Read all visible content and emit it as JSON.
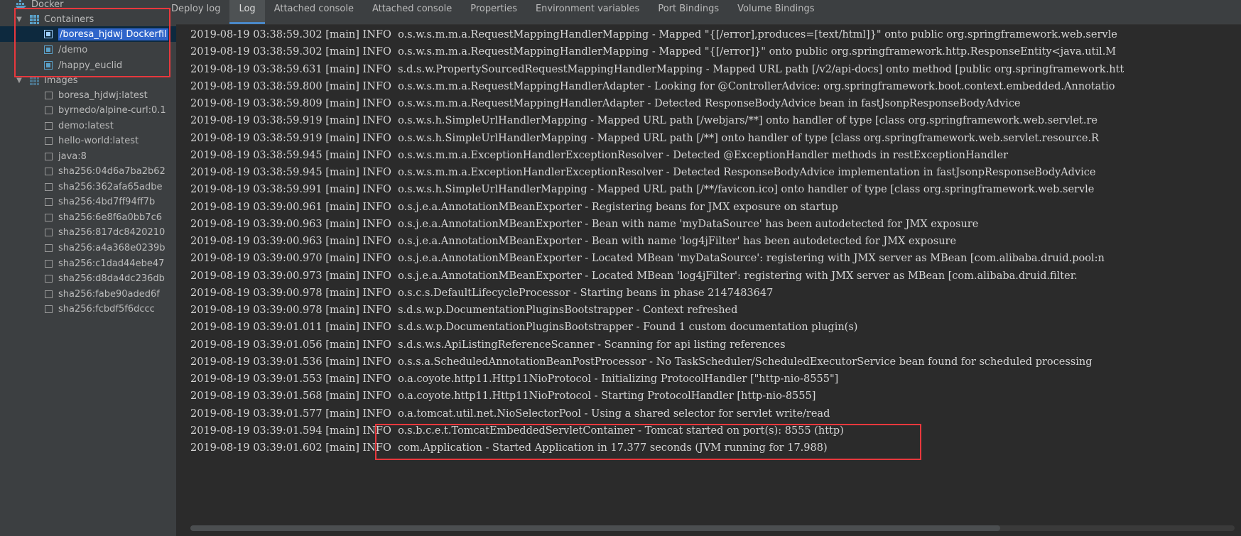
{
  "sidebar": {
    "root": "Docker",
    "containers_label": "Containers",
    "containers": [
      "/boresa_hjdwj Dockerfil",
      "/demo",
      "/happy_euclid"
    ],
    "images_label": "Images",
    "images": [
      "boresa_hjdwj:latest",
      "byrnedo/alpine-curl:0.1",
      "demo:latest",
      "hello-world:latest",
      "java:8",
      "sha256:04d6a7ba2b62",
      "sha256:362afa65adbe",
      "sha256:4bd7ff94ff7b",
      "sha256:6e8f6a0bb7c6",
      "sha256:817dc8420210",
      "sha256:a4a368e0239b",
      "sha256:c1dad44ebe47",
      "sha256:d8da4dc236db",
      "sha256:fabe90aded6f",
      "sha256:fcbdf5f6dccc"
    ]
  },
  "tabs": [
    {
      "label": "Deploy log",
      "active": false
    },
    {
      "label": "Log",
      "active": true
    },
    {
      "label": "Attached console",
      "active": false
    },
    {
      "label": "Attached console",
      "active": false
    },
    {
      "label": "Properties",
      "active": false
    },
    {
      "label": "Environment variables",
      "active": false
    },
    {
      "label": "Port Bindings",
      "active": false
    },
    {
      "label": "Volume Bindings",
      "active": false
    }
  ],
  "log_lines": [
    "2019-08-19 03:38:59.302 [main] INFO  o.s.w.s.m.m.a.RequestMappingHandlerMapping - Mapped \"{[/error],produces=[text/html]}\" onto public org.springframework.web.servle",
    "2019-08-19 03:38:59.302 [main] INFO  o.s.w.s.m.m.a.RequestMappingHandlerMapping - Mapped \"{[/error]}\" onto public org.springframework.http.ResponseEntity<java.util.M",
    "2019-08-19 03:38:59.631 [main] INFO  s.d.s.w.PropertySourcedRequestMappingHandlerMapping - Mapped URL path [/v2/api-docs] onto method [public org.springframework.htt",
    "2019-08-19 03:38:59.800 [main] INFO  o.s.w.s.m.m.a.RequestMappingHandlerAdapter - Looking for @ControllerAdvice: org.springframework.boot.context.embedded.Annotatio",
    "2019-08-19 03:38:59.809 [main] INFO  o.s.w.s.m.m.a.RequestMappingHandlerAdapter - Detected ResponseBodyAdvice bean in fastJsonpResponseBodyAdvice",
    "2019-08-19 03:38:59.919 [main] INFO  o.s.w.s.h.SimpleUrlHandlerMapping - Mapped URL path [/webjars/**] onto handler of type [class org.springframework.web.servlet.re",
    "2019-08-19 03:38:59.919 [main] INFO  o.s.w.s.h.SimpleUrlHandlerMapping - Mapped URL path [/**] onto handler of type [class org.springframework.web.servlet.resource.R",
    "2019-08-19 03:38:59.945 [main] INFO  o.s.w.s.m.m.a.ExceptionHandlerExceptionResolver - Detected @ExceptionHandler methods in restExceptionHandler",
    "2019-08-19 03:38:59.945 [main] INFO  o.s.w.s.m.m.a.ExceptionHandlerExceptionResolver - Detected ResponseBodyAdvice implementation in fastJsonpResponseBodyAdvice",
    "2019-08-19 03:38:59.991 [main] INFO  o.s.w.s.h.SimpleUrlHandlerMapping - Mapped URL path [/**/favicon.ico] onto handler of type [class org.springframework.web.servle",
    "2019-08-19 03:39:00.961 [main] INFO  o.s.j.e.a.AnnotationMBeanExporter - Registering beans for JMX exposure on startup",
    "2019-08-19 03:39:00.963 [main] INFO  o.s.j.e.a.AnnotationMBeanExporter - Bean with name 'myDataSource' has been autodetected for JMX exposure",
    "2019-08-19 03:39:00.963 [main] INFO  o.s.j.e.a.AnnotationMBeanExporter - Bean with name 'log4jFilter' has been autodetected for JMX exposure",
    "2019-08-19 03:39:00.970 [main] INFO  o.s.j.e.a.AnnotationMBeanExporter - Located MBean 'myDataSource': registering with JMX server as MBean [com.alibaba.druid.pool:n",
    "2019-08-19 03:39:00.973 [main] INFO  o.s.j.e.a.AnnotationMBeanExporter - Located MBean 'log4jFilter': registering with JMX server as MBean [com.alibaba.druid.filter.",
    "2019-08-19 03:39:00.978 [main] INFO  o.s.c.s.DefaultLifecycleProcessor - Starting beans in phase 2147483647",
    "2019-08-19 03:39:00.978 [main] INFO  s.d.s.w.p.DocumentationPluginsBootstrapper - Context refreshed",
    "2019-08-19 03:39:01.011 [main] INFO  s.d.s.w.p.DocumentationPluginsBootstrapper - Found 1 custom documentation plugin(s)",
    "2019-08-19 03:39:01.056 [main] INFO  s.d.s.w.s.ApiListingReferenceScanner - Scanning for api listing references",
    "2019-08-19 03:39:01.536 [main] INFO  o.s.s.a.ScheduledAnnotationBeanPostProcessor - No TaskScheduler/ScheduledExecutorService bean found for scheduled processing",
    "2019-08-19 03:39:01.553 [main] INFO  o.a.coyote.http11.Http11NioProtocol - Initializing ProtocolHandler [\"http-nio-8555\"]",
    "2019-08-19 03:39:01.568 [main] INFO  o.a.coyote.http11.Http11NioProtocol - Starting ProtocolHandler [http-nio-8555]",
    "2019-08-19 03:39:01.577 [main] INFO  o.a.tomcat.util.net.NioSelectorPool - Using a shared selector for servlet write/read",
    "2019-08-19 03:39:01.594 [main] INFO  o.s.b.c.e.t.TomcatEmbeddedServletContainer - Tomcat started on port(s): 8555 (http)",
    "2019-08-19 03:39:01.602 [main] INFO  com.Application - Started Application in 17.377 seconds (JVM running for 17.988)"
  ],
  "colors": {
    "highlight": "#e8383d",
    "selection": "#2f65ca",
    "tab_underline": "#4a88c7"
  }
}
